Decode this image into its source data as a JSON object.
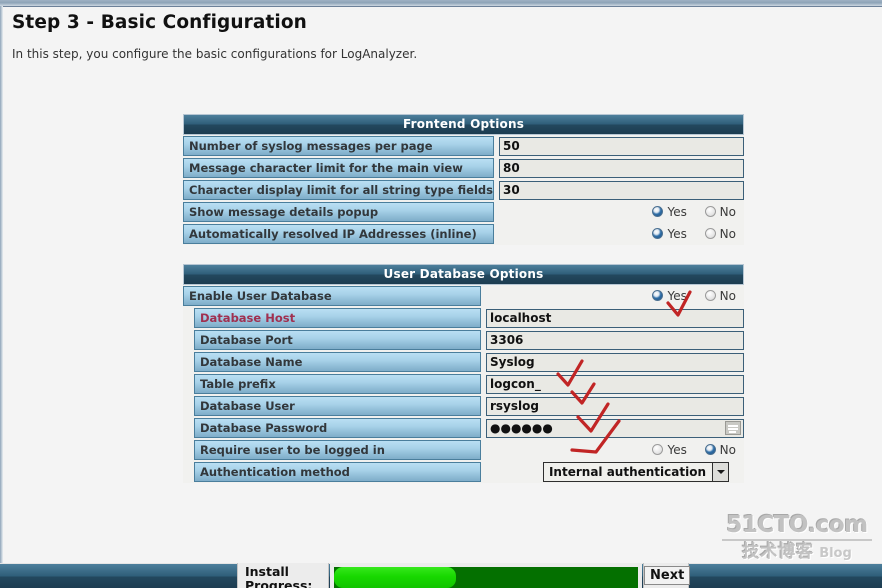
{
  "page": {
    "title": "Step 3 - Basic Configuration",
    "subtitle": "In this step, you configure the basic configurations for LogAnalyzer."
  },
  "frontend": {
    "section_title": "Frontend Options",
    "rows": [
      {
        "label": "Number of syslog messages per page",
        "type": "text",
        "value": "50"
      },
      {
        "label": "Message character limit for the main view",
        "type": "text",
        "value": "80"
      },
      {
        "label": "Character display limit for all string type fields",
        "type": "text",
        "value": "30"
      },
      {
        "label": "Show message details popup",
        "type": "radio",
        "selected": "Yes"
      },
      {
        "label": "Automatically resolved IP Addresses (inline)",
        "type": "radio",
        "selected": "Yes"
      }
    ]
  },
  "userdb": {
    "section_title": "User Database Options",
    "enable": {
      "label": "Enable User Database",
      "selected": "Yes"
    },
    "rows": [
      {
        "label": "Database Host",
        "value": "localhost",
        "highlight": true
      },
      {
        "label": "Database Port",
        "value": "3306",
        "highlight": false
      },
      {
        "label": "Database Name",
        "value": "Syslog",
        "highlight": false
      },
      {
        "label": "Table prefix",
        "value": "logcon_",
        "highlight": false
      },
      {
        "label": "Database User",
        "value": "rsyslog",
        "highlight": false
      },
      {
        "label": "Database Password",
        "value": "●●●●●●",
        "highlight": false
      }
    ],
    "require_login": {
      "label": "Require user to be logged in",
      "selected": "No"
    },
    "auth_method": {
      "label": "Authentication method",
      "value": "Internal authentication"
    }
  },
  "radio_options": {
    "yes": "Yes",
    "no": "No"
  },
  "bottom_bar": {
    "install_label": "Install Progress:",
    "progress_percent": 40,
    "next_label": "Next"
  },
  "watermark": {
    "main": "51CTO.com",
    "cn": "技术博客",
    "en": "Blog"
  },
  "colors": {
    "section_header": "#2f5e79",
    "label_cell": "#a8d2e9",
    "highlight_label_text": "#a03050",
    "annotation": "#c12525",
    "progress_fill": "#18d800",
    "progress_track": "#047000"
  }
}
